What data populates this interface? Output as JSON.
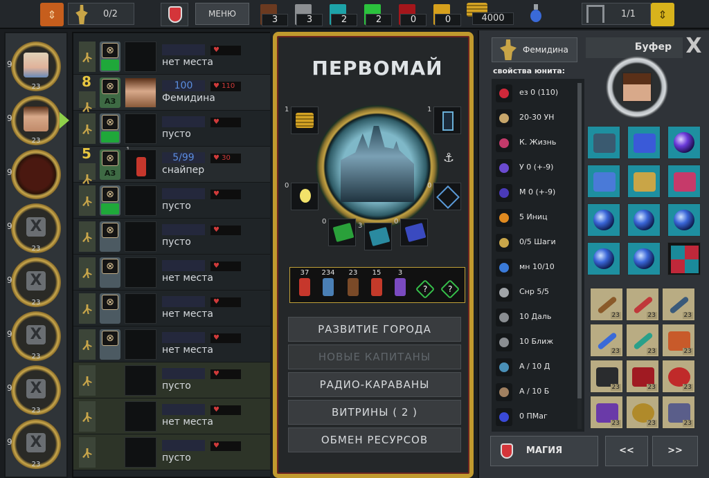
{
  "topbar": {
    "party_count": "0/2",
    "menu_label": "МЕНЮ",
    "resources": [
      {
        "icon": "brown-resource-icon",
        "value": "3",
        "color": "#6b3a20"
      },
      {
        "icon": "gray-resource-icon",
        "value": "3",
        "color": "#8c8f92"
      },
      {
        "icon": "teal-resource-icon",
        "value": "2",
        "color": "#1da3a8"
      },
      {
        "icon": "green-resource-icon",
        "value": "2",
        "color": "#2bc23d"
      },
      {
        "icon": "red-resource-icon",
        "value": "0",
        "color": "#a4161b"
      },
      {
        "icon": "gold-resource-icon",
        "value": "0",
        "color": "#d6a01c"
      }
    ],
    "gold": "4000",
    "gate_count": "1/1"
  },
  "left_slots": [
    {
      "kind": "portrait",
      "side": "9",
      "level": "23"
    },
    {
      "kind": "portrait",
      "side": "9",
      "level": "23"
    },
    {
      "kind": "empty",
      "side": "9",
      "level": ""
    },
    {
      "kind": "locked",
      "side": "9",
      "level": "23"
    },
    {
      "kind": "locked",
      "side": "9",
      "level": "23"
    },
    {
      "kind": "locked",
      "side": "9",
      "level": "23"
    },
    {
      "kind": "locked",
      "side": "9",
      "level": "23"
    },
    {
      "kind": "locked",
      "side": "9",
      "level": "23"
    }
  ],
  "units": [
    {
      "name": "нет места",
      "stat": "",
      "hp": "",
      "big": "",
      "small": "",
      "az": false,
      "green": true,
      "portrait": false
    },
    {
      "name": "Фемидина",
      "stat": "100",
      "hp": "110",
      "big": "8",
      "small": "",
      "az": true,
      "green": false,
      "portrait": true
    },
    {
      "name": "пусто",
      "stat": "",
      "hp": "",
      "big": "",
      "small": "",
      "az": false,
      "green": true,
      "portrait": false
    },
    {
      "name": "снайпер",
      "stat": "5/99",
      "hp": "30",
      "big": "5",
      "small": "1",
      "az": true,
      "green": false,
      "portrait": true
    },
    {
      "name": "пусто",
      "stat": "",
      "hp": "",
      "big": "",
      "small": "",
      "az": false,
      "green": true,
      "portrait": false
    },
    {
      "name": "пусто",
      "stat": "",
      "hp": "",
      "big": "",
      "small": "",
      "az": false,
      "green": false,
      "portrait": false
    },
    {
      "name": "нет места",
      "stat": "",
      "hp": "",
      "big": "",
      "small": "",
      "az": false,
      "green": false,
      "portrait": false
    },
    {
      "name": "нет места",
      "stat": "",
      "hp": "",
      "big": "",
      "small": "",
      "az": false,
      "green": false,
      "portrait": false
    },
    {
      "name": "нет места",
      "stat": "",
      "hp": "",
      "big": "",
      "small": "",
      "az": false,
      "green": false,
      "portrait": false
    },
    {
      "name": "пусто",
      "stat": "",
      "hp": "",
      "big": "",
      "small": "",
      "az": false,
      "green": false,
      "portrait": false
    },
    {
      "name": "нет места",
      "stat": "",
      "hp": "",
      "big": "",
      "small": "",
      "az": false,
      "green": false,
      "portrait": false
    },
    {
      "name": "пусто",
      "stat": "",
      "hp": "",
      "big": "",
      "small": "",
      "az": false,
      "green": false,
      "portrait": false
    }
  ],
  "city": {
    "title": "ПЕРВОМАЙ",
    "slot_counts": {
      "coins": "1",
      "scroll": "1",
      "bulb": "0",
      "tools": "0",
      "book_green": "0",
      "book_teal": "3",
      "book_blue": "0"
    },
    "strip": [
      {
        "count": "37",
        "color": "#c6372c"
      },
      {
        "count": "234",
        "color": "#4a7fb5"
      },
      {
        "count": "23",
        "color": "#7a4a28"
      },
      {
        "count": "15",
        "color": "#c43a2a"
      },
      {
        "count": "3",
        "color": "#7a4ac0"
      },
      {
        "count": "",
        "color": "",
        "q": "?"
      },
      {
        "count": "",
        "color": "",
        "q": "?"
      }
    ],
    "menu": [
      {
        "label": "РАЗВИТИЕ ГОРОДА",
        "enabled": true
      },
      {
        "label": "НОВЫЕ КАПИТАНЫ",
        "enabled": false
      },
      {
        "label": "РАДИО-КАРАВАНЫ",
        "enabled": true
      },
      {
        "label": "ВИТРИНЫ ( 2 )",
        "enabled": true
      },
      {
        "label": "ОБМЕН РЕСУРСОВ",
        "enabled": true
      }
    ]
  },
  "right": {
    "tab_label": "Фемидина",
    "buffer_label": "Буфер",
    "props_title": "свойства юнита:",
    "props": [
      {
        "icon": "heart-icon",
        "text": "ез 0 (110)",
        "color": "#d0283a"
      },
      {
        "icon": "shield-heart-icon",
        "text": "20-30 УН",
        "color": "#c7a66b"
      },
      {
        "icon": "life-icon",
        "text": "К. Жизнь",
        "color": "#c23a6a"
      },
      {
        "icon": "defense-icon",
        "text": "У 0 (+-9)",
        "color": "#6a4ad0"
      },
      {
        "icon": "magic-defense-icon",
        "text": "М 0 (+-9)",
        "color": "#4a3ab8"
      },
      {
        "icon": "initiative-icon",
        "text": "5 Иниц",
        "color": "#e08a20"
      },
      {
        "icon": "steps-icon",
        "text": "0/5 Шаги",
        "color": "#c9a64a"
      },
      {
        "icon": "mana-icon",
        "text": "мн 10/10",
        "color": "#3a7ad8"
      },
      {
        "icon": "ammo-icon",
        "text": "Снр 5/5",
        "color": "#a0a4a8"
      },
      {
        "icon": "ranged-icon",
        "text": "10 Даль",
        "color": "#8a8e92"
      },
      {
        "icon": "melee-icon",
        "text": "10 Ближ",
        "color": "#8a8e92"
      },
      {
        "icon": "ranged-attack-icon",
        "text": "А / 10 Д",
        "color": "#4a90b8"
      },
      {
        "icon": "melee-attack-icon",
        "text": "А / 10 Б",
        "color": "#a08060"
      },
      {
        "icon": "magic-icon",
        "text": "0 ПМаг",
        "color": "#3a4ad8"
      }
    ],
    "magic_label": "МАГИЯ",
    "prev_label": "<<",
    "next_label": ">>",
    "item_level": "23"
  }
}
